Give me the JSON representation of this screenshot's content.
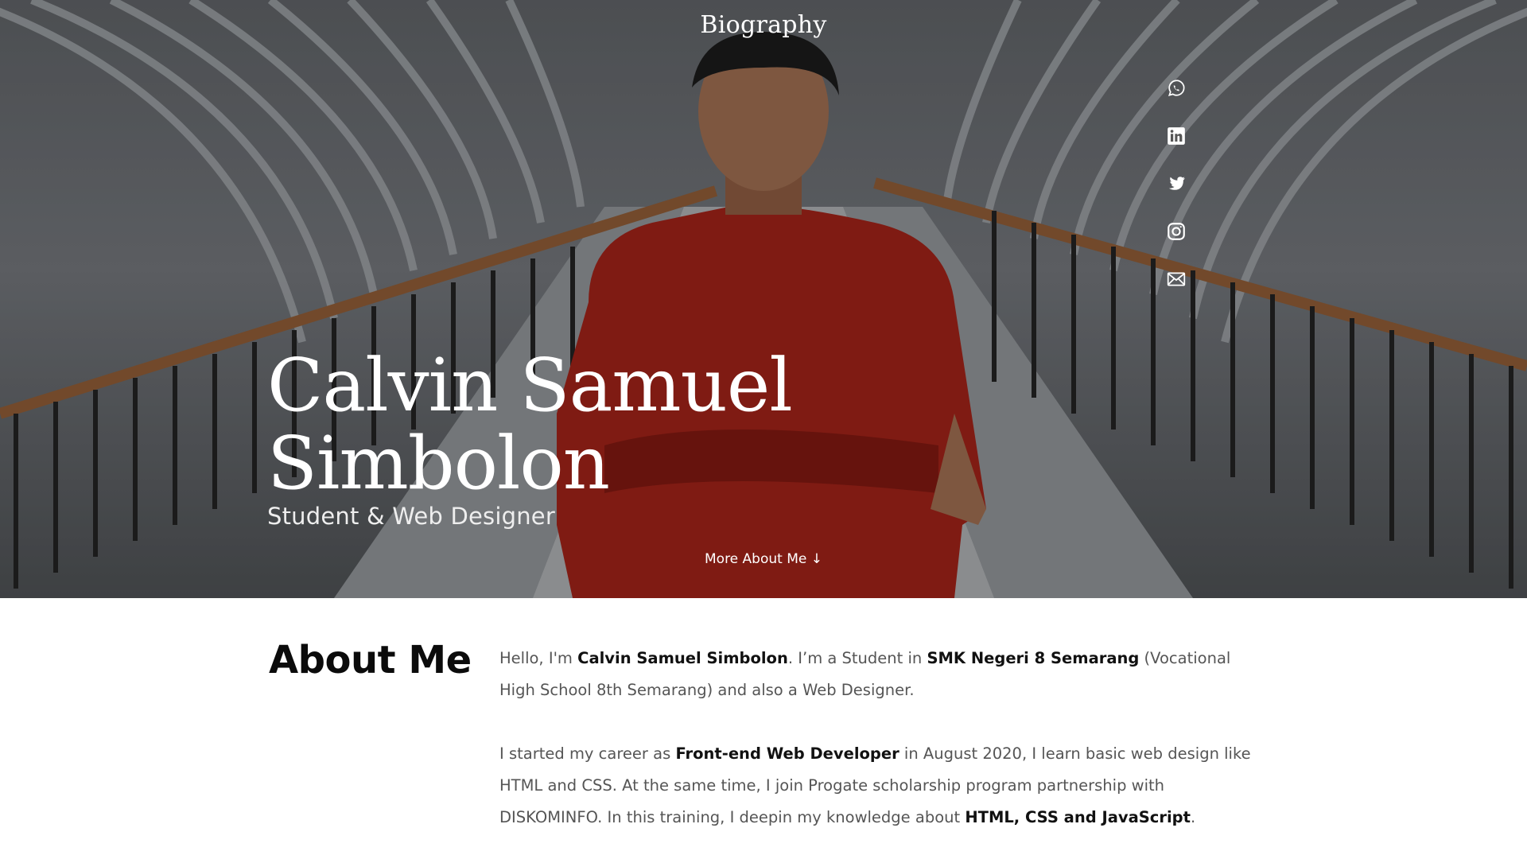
{
  "nav": {
    "title": "Biography"
  },
  "social": [
    {
      "name": "whatsapp-icon"
    },
    {
      "name": "linkedin-icon"
    },
    {
      "name": "twitter-icon"
    },
    {
      "name": "instagram-icon"
    },
    {
      "name": "mail-icon"
    }
  ],
  "hero": {
    "name_line1": "Calvin Samuel",
    "name_line2": "Simbolon",
    "subtitle": "Student & Web Designer",
    "more_link": "More About Me ↓"
  },
  "about": {
    "heading": "About Me",
    "p1": {
      "t1": "Hello, I'm ",
      "b1": "Calvin Samuel Simbolon",
      "t2": ". I’m a Student in ",
      "b2": "SMK Negeri 8 Semarang",
      "t3": " (Vocational High School 8th Semarang) and also a Web Designer."
    },
    "p2": {
      "t1": "I started my career as ",
      "b1": "Front-end Web Developer",
      "t2": " in August 2020, I learn basic web design like HTML and CSS. At the same time, I join Progate scholarship program partnership with DISKOMINFO. In this training, I deepin my knowledge about ",
      "b2": "HTML, CSS and JavaScript",
      "t3": "."
    }
  },
  "colors": {
    "shirt": "#9b2218",
    "background": "#ffffff",
    "heading": "#0b0b0b",
    "body_text": "#555555"
  }
}
